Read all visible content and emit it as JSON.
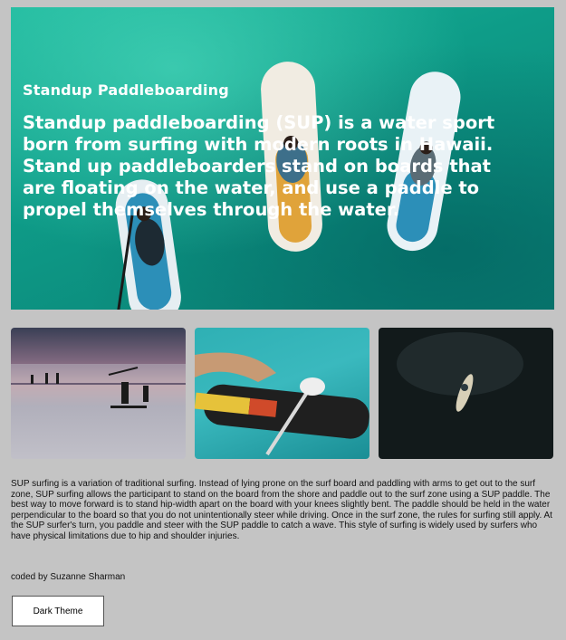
{
  "hero": {
    "kicker": "Standup Paddleboarding",
    "text": "Standup paddleboarding (SUP) is a water sport born from surfing with modern roots in Hawaii. Stand up paddleboarders stand on boards that are floating on the water, and use a paddle to propel themselves through the water."
  },
  "gallery": {
    "items": [
      {
        "name": "sunset paddleboarders"
      },
      {
        "name": "paddleboard close-up"
      },
      {
        "name": "lone paddleboarder dark water"
      }
    ]
  },
  "body": {
    "paragraph": "SUP surfing is a variation of traditional surfing. Instead of lying prone on the surf board and paddling with arms to get out to the surf zone, SUP surfing allows the participant to stand on the board from the shore and paddle out to the surf zone using a SUP paddle. The best way to move forward is to stand hip-width apart on the board with your knees slightly bent. The paddle should be held in the water perpendicular to the board so that you do not unintentionally steer while driving. Once in the surf zone, the rules for surfing still apply. At the SUP surfer's turn, you paddle and steer with the SUP paddle to catch a wave. This style of surfing is widely used by surfers who have physical limitations due to hip and shoulder injuries."
  },
  "footer": {
    "credit": "coded by Suzanne Sharman",
    "theme_button": "Dark Theme"
  },
  "colors": {
    "page_bg": "#c4c4c4",
    "water": "#0e9c88"
  }
}
